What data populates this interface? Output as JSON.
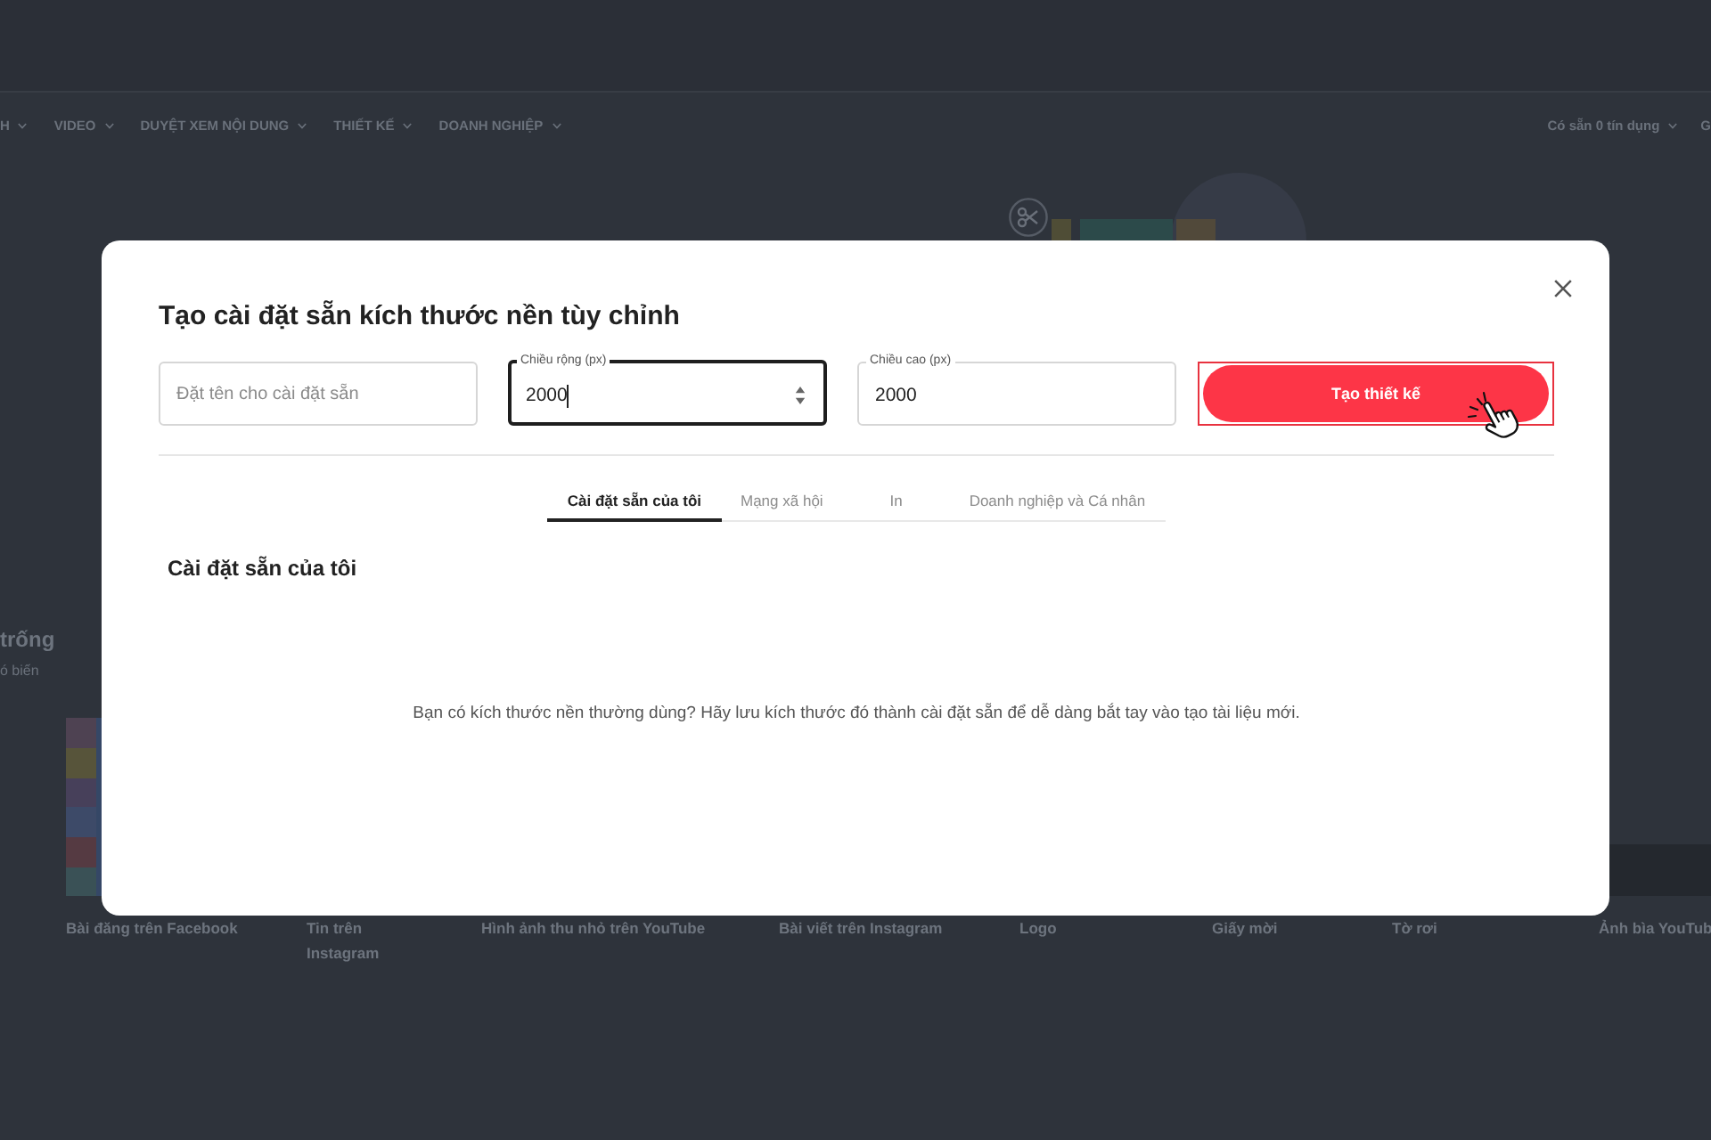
{
  "top_nav": {
    "menu": [
      {
        "label": "H",
        "dropdown": true
      },
      {
        "label": "VIDEO",
        "dropdown": true
      },
      {
        "label": "DUYỆT XEM NỘI DUNG",
        "dropdown": true
      },
      {
        "label": "THIẾT KẾ",
        "dropdown": true
      },
      {
        "label": "DOANH NGHIỆP",
        "dropdown": true
      }
    ],
    "right": [
      {
        "label": "Có sẵn 0 tín dụng",
        "dropdown": true
      },
      {
        "label": "G",
        "dropdown": false
      }
    ]
  },
  "section": {
    "heading": "trống",
    "subheading": "ó biến"
  },
  "templates": [
    {
      "label": "Bài đăng trên Facebook"
    },
    {
      "label": "Tin trên Instagram"
    },
    {
      "label": "Hình ảnh thu nhỏ trên YouTube"
    },
    {
      "label": "Bài viết trên Instagram"
    },
    {
      "label": "Logo"
    },
    {
      "label": "Giấy mời"
    },
    {
      "label": "Tờ rơi"
    },
    {
      "label": "Ảnh bìa YouTub"
    }
  ],
  "dialog": {
    "title": "Tạo cài đặt sẵn kích thước nền tùy chỉnh",
    "fields": [
      {
        "placeholder": "Đặt tên cho cài đặt sẵn",
        "focused": false,
        "spinner": false
      },
      {
        "label": "Chiều rộng (px)",
        "value": "2000",
        "focused": true,
        "spinner": true
      },
      {
        "label": "Chiều cao (px)",
        "value": "2000",
        "focused": false,
        "spinner": false
      }
    ],
    "create_button": {
      "label": "Tạo thiết kế",
      "highlighted": true
    },
    "tabs": [
      {
        "label": "Cài đặt sẵn của tôi",
        "selected": true
      },
      {
        "label": "Mạng xã hội",
        "selected": false
      },
      {
        "label": "In",
        "selected": false
      },
      {
        "label": "Doanh nghiệp và Cá nhân",
        "selected": false
      }
    ],
    "section_title": "Cài đặt sẵn của tôi",
    "empty_message": "Bạn có kích thước nền thường dùng? Hãy lưu kích thước đó thành cài đặt sẵn để dễ dàng bắt tay vào tạo tài liệu mới."
  }
}
